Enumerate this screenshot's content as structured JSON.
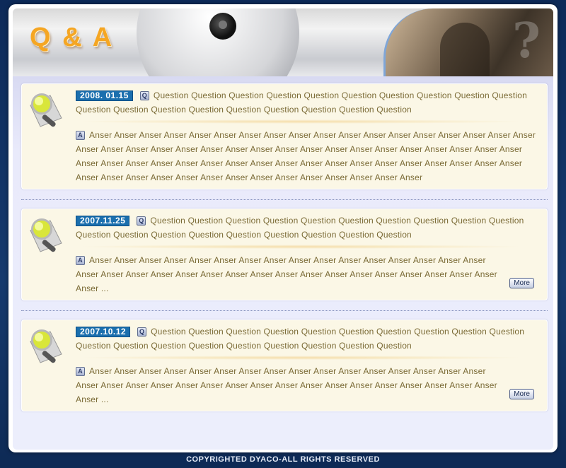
{
  "header": {
    "title": "Q & A"
  },
  "entries": [
    {
      "date": "2008. 01.15",
      "q_badge": "Q",
      "question": "Question Question Question Question Question Question Question Question Question Question Question Question Question Question Question Question Question Question Question",
      "a_badge": "A",
      "answer": "Anser Anser Anser Anser Anser Anser Anser Anser Anser Anser Anser Anser Anser Anser Anser Anser Anser Anser Anser Anser Anser Anser Anser Anser Anser Anser Anser Anser Anser Anser Anser Anser Anser Anser Anser Anser Anser Anser Anser Anser Anser Anser Anser Anser Anser Anser Anser Anser Anser Anser Anser Anser Anser Anser Anser Anser Anser Anser Anser Anser Anser Anser Anser Anser Anser Anser Anser Anser"
    },
    {
      "date": "2007.11.25",
      "q_badge": "Q",
      "question": "Question Question Question Question Question Question Question Question Question Question Question Question Question Question Question Question Question Question Question",
      "a_badge": "A",
      "answer": "Anser Anser Anser Anser Anser Anser Anser Anser Anser Anser Anser Anser Anser Anser Anser Anser Anser Anser Anser Anser Anser Anser Anser Anser Anser Anser Anser Anser Anser Anser Anser Anser Anser Anser ...",
      "more_label": "More"
    },
    {
      "date": "2007.10.12",
      "q_badge": "Q",
      "question": "Question Question Question Question Question Question Question Question Question Question Question Question Question Question Question Question Question Question Question",
      "a_badge": "A",
      "answer": "Anser Anser Anser Anser Anser Anser Anser Anser Anser Anser Anser Anser Anser Anser Anser Anser Anser Anser Anser Anser Anser Anser Anser Anser Anser Anser Anser Anser Anser Anser Anser Anser Anser Anser ...",
      "more_label": "More"
    }
  ],
  "footer": {
    "copyright": "COPYRIGHTED DYACO-ALL RIGHTS RESERVED"
  },
  "colors": {
    "accent": "#f5a623",
    "date_bg": "#1b6fae",
    "text": "#7a6a35",
    "card_bg": "#fbf7e6"
  },
  "icons": {
    "entry_icon": "magnifier-icon"
  }
}
